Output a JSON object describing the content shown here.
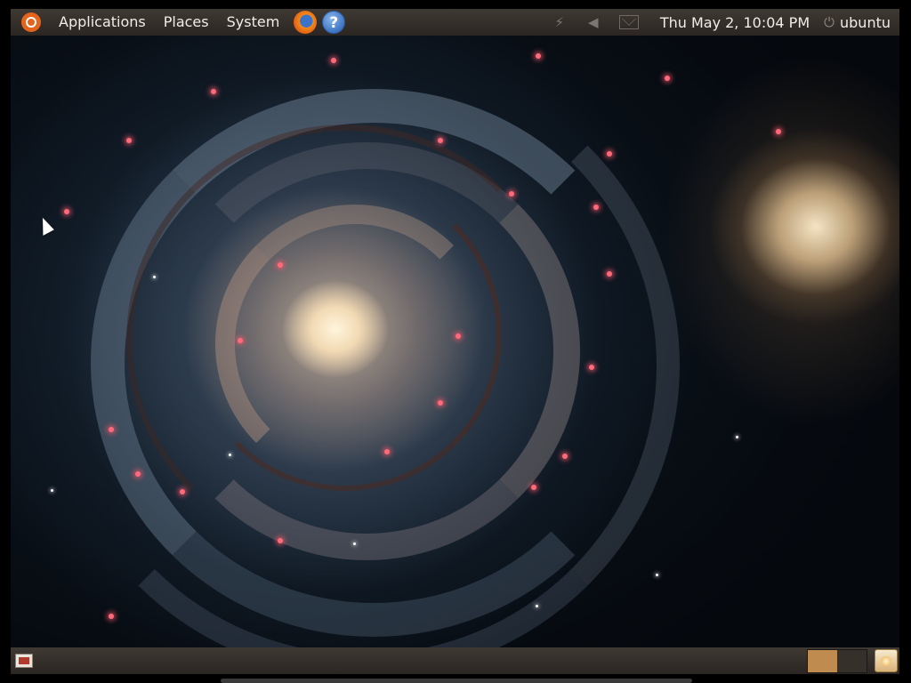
{
  "top_panel": {
    "menus": {
      "applications": "Applications",
      "places": "Places",
      "system": "System"
    },
    "launchers": {
      "help_glyph": "?"
    },
    "clock": "Thu May  2, 10:04 PM",
    "user": "ubuntu",
    "icons": [
      "ubuntu-logo",
      "firefox-icon",
      "help-icon",
      "network-icon",
      "volume-icon",
      "mail-icon",
      "power-icon"
    ]
  },
  "desktop": {
    "wallpaper": "whirlpool-galaxy"
  },
  "bottom_panel": {
    "icons": [
      "show-desktop-icon",
      "trash-icon"
    ],
    "workspaces": [
      "active",
      "inactive"
    ]
  },
  "colors": {
    "panel_background": "#3a342e",
    "ubuntu_orange": "#e4641d",
    "active_workspace": "#c08b4f"
  }
}
